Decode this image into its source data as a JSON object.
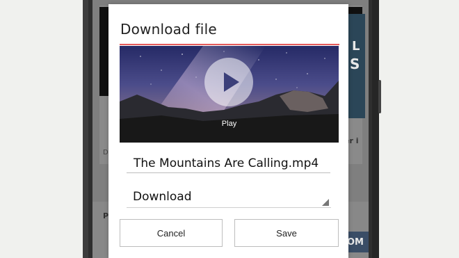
{
  "dialog": {
    "title": "Download file",
    "accent_color": "#e45a5a",
    "preview": {
      "play_label": "Play",
      "play_icon": "play-icon"
    },
    "filename": "The Mountains Are Calling.mp4",
    "location_select": {
      "value": "Download",
      "icon": "dropdown-corner-icon"
    },
    "buttons": {
      "cancel_label": "Cancel",
      "save_label": "Save"
    }
  },
  "background": {
    "fragment_left": "D",
    "fragment_right_top": "L",
    "fragment_right_mid": "S",
    "fragment_right_text": "er i",
    "fragment_section": "P",
    "fragment_bottom_right": "OM"
  }
}
